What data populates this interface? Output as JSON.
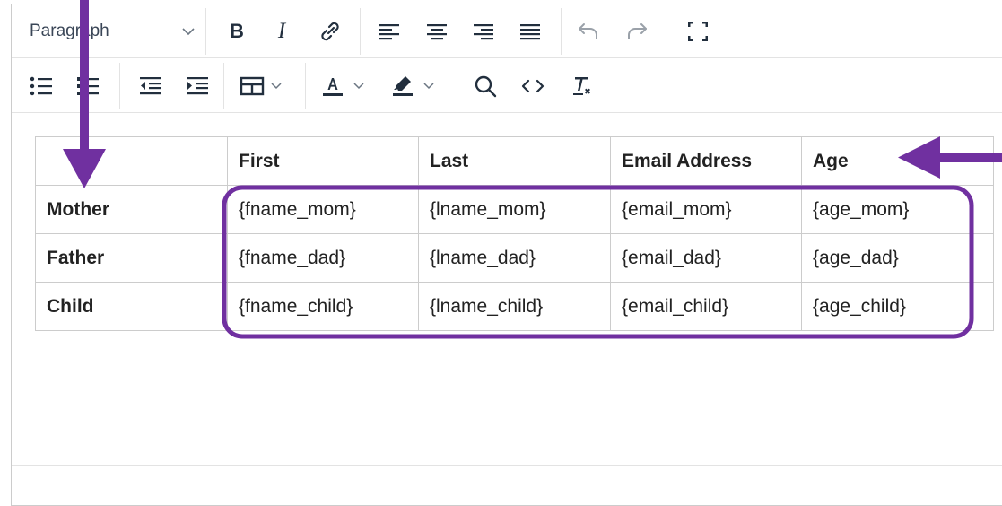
{
  "toolbar": {
    "block_format": "Paragraph",
    "bold_label": "B",
    "italic_label": "I"
  },
  "icons": {
    "row1": [
      "bold-icon",
      "italic-icon",
      "link-icon",
      "align-left-icon",
      "align-center-icon",
      "align-right-icon",
      "justify-icon",
      "undo-icon",
      "redo-icon",
      "fullscreen-icon"
    ],
    "row2": [
      "bullet-list-icon",
      "numbered-list-icon",
      "outdent-icon",
      "indent-icon",
      "table-icon",
      "text-color-icon",
      "highlight-icon",
      "search-icon",
      "code-icon",
      "clear-formatting-icon"
    ]
  },
  "colors": {
    "annotation": "#7030a0",
    "text_color_bar": "#222f3e",
    "highlight_bar": "#222f3e"
  },
  "table": {
    "headers": [
      "",
      "First",
      "Last",
      "Email Address",
      "Age"
    ],
    "rows": [
      {
        "label": "Mother",
        "cells": [
          "{fname_mom}",
          "{lname_mom}",
          "{email_mom}",
          "{age_mom}"
        ]
      },
      {
        "label": "Father",
        "cells": [
          "{fname_dad}",
          "{lname_dad}",
          "{email_dad}",
          "{age_dad}"
        ]
      },
      {
        "label": "Child",
        "cells": [
          "{fname_child}",
          "{lname_child}",
          "{email_child}",
          "{age_child}"
        ]
      }
    ]
  }
}
